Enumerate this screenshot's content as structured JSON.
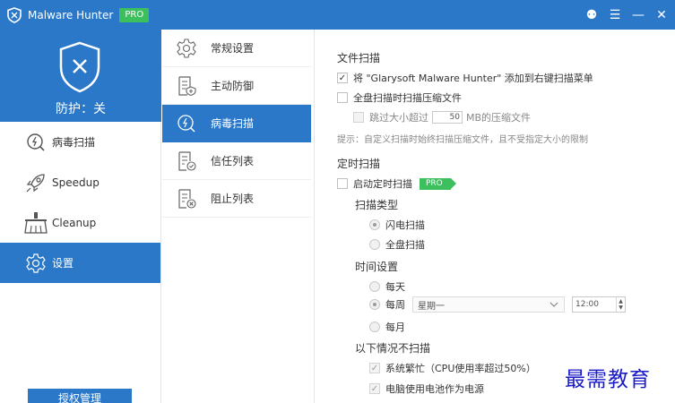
{
  "titlebar": {
    "app_name": "Malware Hunter",
    "pro_label": "PRO",
    "controls": [
      "⚉",
      "☰",
      "—",
      "✕"
    ]
  },
  "left": {
    "status": "防护：关",
    "nav": [
      {
        "label": "病毒扫描",
        "icon": "virus-scan-icon"
      },
      {
        "label": "Speedup",
        "icon": "rocket-icon"
      },
      {
        "label": "Cleanup",
        "icon": "broom-icon"
      },
      {
        "label": "设置",
        "icon": "gear-icon",
        "active": true
      }
    ],
    "auth_button": "授权管理"
  },
  "submenu": [
    {
      "label": "常规设置",
      "icon": "gear-icon"
    },
    {
      "label": "主动防御",
      "icon": "shield-doc-icon"
    },
    {
      "label": "病毒扫描",
      "icon": "virus-scan-icon",
      "active": true
    },
    {
      "label": "信任列表",
      "icon": "trust-list-icon"
    },
    {
      "label": "阻止列表",
      "icon": "block-list-icon"
    }
  ],
  "file_scan": {
    "title": "文件扫描",
    "add_context_menu": "将 \"Glarysoft Malware Hunter\" 添加到右键扫描菜单",
    "full_scan_compressed": "全盘扫描时扫描压缩文件",
    "skip_size_prefix": "跳过大小超过",
    "skip_size_value": "50",
    "skip_size_suffix": "MB的压缩文件",
    "hint": "提示：自定义扫描时始终扫描压缩文件，且不受指定大小的限制"
  },
  "scheduled": {
    "title": "定时扫描",
    "enable_label": "启动定时扫描",
    "pro_label": "PRO",
    "scan_type_title": "扫描类型",
    "scan_types": [
      "闪电扫描",
      "全盘扫描"
    ],
    "time_title": "时间设置",
    "daily": "每天",
    "weekly": "每周",
    "weekday": "星期一",
    "time_value": "12:00",
    "monthly": "每月",
    "skip_title": "以下情况不扫描",
    "skip_busy": "系统繁忙（CPU使用率超过50%）",
    "skip_battery": "电脑使用电池作为电源"
  },
  "watermark": "最需教育",
  "colors": {
    "accent": "#2b78c9",
    "pro_green": "#3cbf5d"
  }
}
